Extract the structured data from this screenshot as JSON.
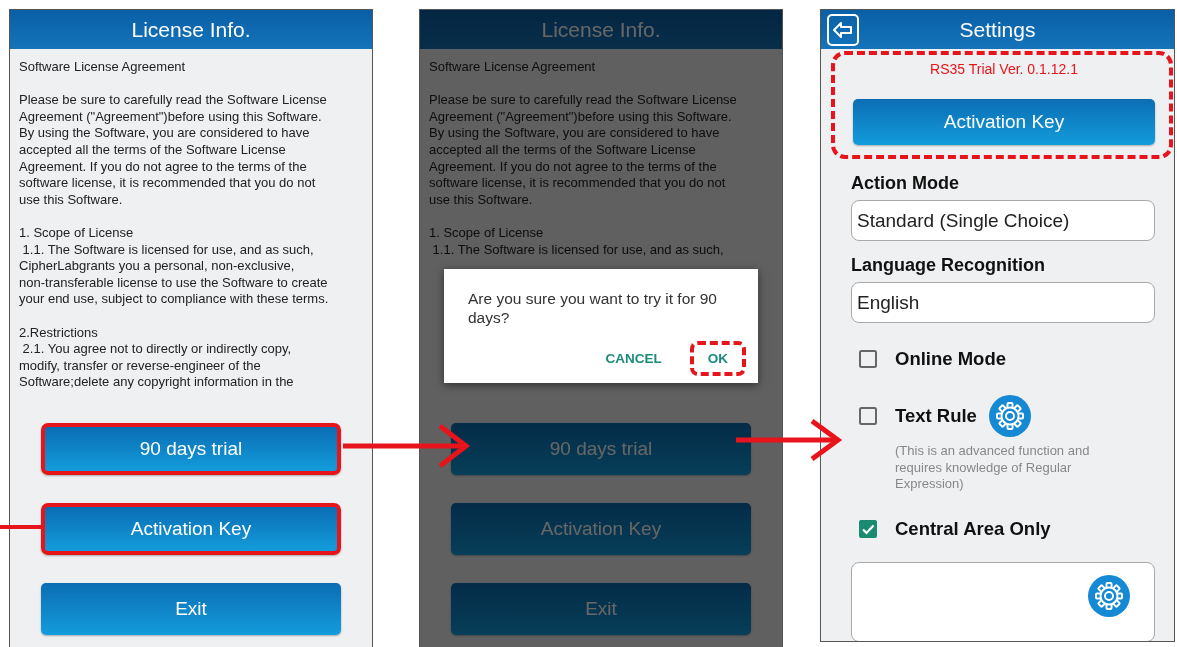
{
  "screens": [
    {
      "kind": "license",
      "title": "License Info.",
      "dimmed": false,
      "paragraphs": [
        "Software License Agreement",
        "Please be sure to carefully read the Software License\nAgreement (\"Agreement\")before using this Software.\nBy using the Software, you are considered to have\naccepted all the terms of the Software License\nAgreement. If you do not agree to the terms of the\nsoftware license, it is recommended that you do not\nuse this Software.",
        "1. Scope of License\n 1.1. The Software is licensed for use, and as such,\nCipherLabgrants you a personal, non-exclusive,\nnon-transferable license to use the Software to create\nyour end use, subject to compliance with these terms.",
        "2.Restrictions\n 2.1. You agree not to directly or indirectly copy,\nmodify, transfer or reverse-engineer of the\nSoftware;delete any copyright information in the"
      ],
      "buttons": [
        {
          "label": "90 days trial",
          "highlighted": true
        },
        {
          "label": "Activation Key",
          "highlighted": true
        },
        {
          "label": "Exit",
          "highlighted": false
        }
      ]
    },
    {
      "kind": "license",
      "title": "License Info.",
      "dimmed": true,
      "paragraphs": [
        "Software License Agreement",
        "Please be sure to carefully read the Software License\nAgreement (\"Agreement\")before using this Software.\nBy using the Software, you are considered to have\naccepted all the terms of the Software License\nAgreement. If you do not agree to the terms of the\nsoftware license, it is recommended that you do not\nuse this Software.",
        "1. Scope of License\n 1.1. The Software is licensed for use, and as such,"
      ],
      "buttons": [
        {
          "label": "90 days trial",
          "highlighted": false
        },
        {
          "label": "Activation Key",
          "highlighted": false
        },
        {
          "label": "Exit",
          "highlighted": false
        }
      ],
      "dialog": {
        "message": "Are you sure you want to try it for 90 days?",
        "actions": [
          {
            "label": "CANCEL",
            "highlighted": false
          },
          {
            "label": "OK",
            "highlighted": true
          }
        ]
      }
    },
    {
      "kind": "settings",
      "title": "Settings",
      "version": "RS35 Trial Ver. 0.1.12.1",
      "highlighted": true,
      "button": "Activation Key",
      "fields": [
        {
          "label": "Action Mode",
          "value": "Standard (Single Choice)"
        },
        {
          "label": "Language Recognition",
          "value": "English"
        }
      ],
      "options": [
        {
          "label": "Online Mode",
          "checked": false
        },
        {
          "label": "Text Rule",
          "checked": false,
          "gear": true,
          "note": "(This is an advanced function and requires knowledge of Regular Expression)"
        },
        {
          "label": "Central Area Only",
          "checked": true
        }
      ]
    }
  ]
}
